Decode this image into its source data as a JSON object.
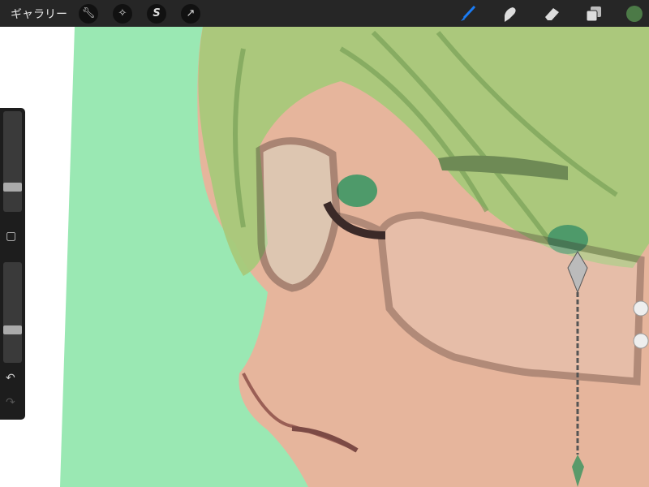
{
  "topbar": {
    "gallery_label": "ギャラリー",
    "left_tools": [
      {
        "name": "actions",
        "icon": "wrench-icon"
      },
      {
        "name": "adjustments",
        "icon": "magic-wand-icon"
      },
      {
        "name": "selection",
        "icon": "selection-s-icon"
      },
      {
        "name": "transform",
        "icon": "arrow-cursor-icon"
      }
    ],
    "right_tools": [
      {
        "name": "brush",
        "icon": "brush-icon",
        "active": true
      },
      {
        "name": "smudge",
        "icon": "smudge-finger-icon"
      },
      {
        "name": "eraser",
        "icon": "eraser-icon"
      },
      {
        "name": "layers",
        "icon": "layers-icon"
      }
    ],
    "active_color": "#4c7a47",
    "accent": "#1a7cf5"
  },
  "sidebar": {
    "brush_size": 0.25,
    "opacity": 0.35
  },
  "colors": {
    "background_green": "#9ae8b3",
    "skin": "#e8b8a0",
    "hair": "#a9c97e"
  }
}
